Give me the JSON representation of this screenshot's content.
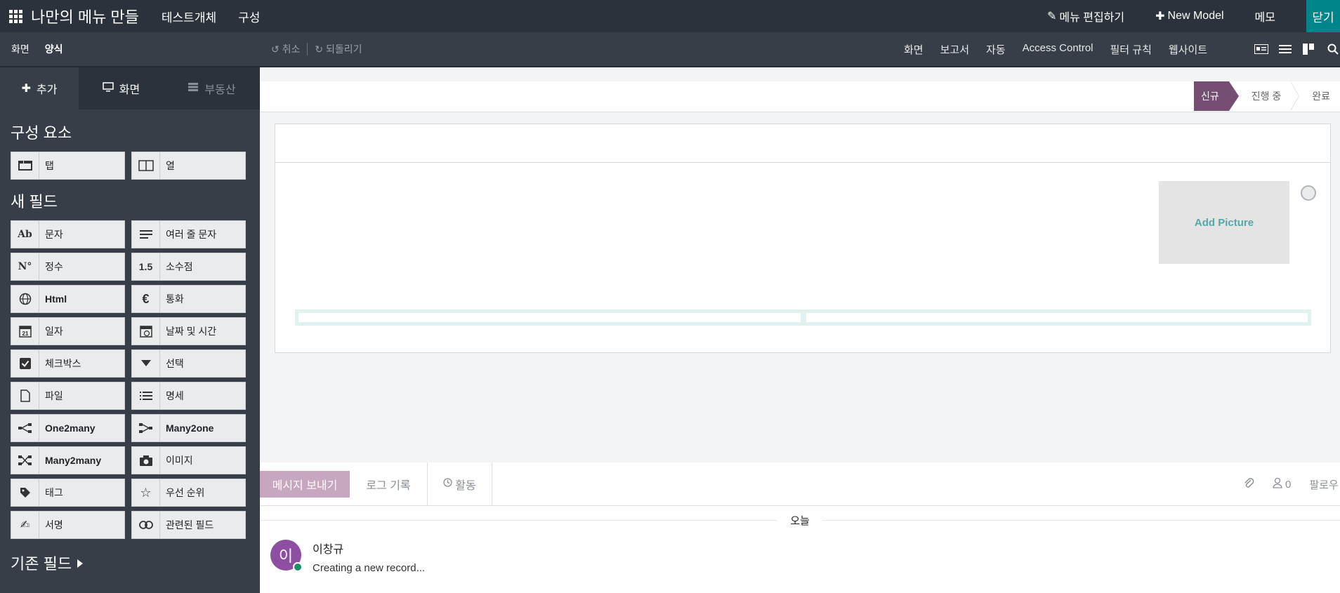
{
  "topbar": {
    "app_title": "나만의 메뉴 만들",
    "menus": [
      "테스트개체",
      "구성"
    ],
    "edit_menu": "메뉴 편집하기",
    "new_model": "New Model",
    "memo": "메모",
    "close": "닫기"
  },
  "subbar": {
    "left": [
      "화면",
      "양식"
    ],
    "undo": "취소",
    "redo": "되돌리기",
    "right": [
      "화면",
      "보고서",
      "자동",
      "Access Control",
      "필터 규칙",
      "웹사이트"
    ]
  },
  "sidebar": {
    "tabs": [
      "추가",
      "화면",
      "부동산"
    ],
    "components_title": "구성 요소",
    "components": [
      {
        "icon": "tab-icon",
        "label": "탭"
      },
      {
        "icon": "columns-icon",
        "label": "열"
      }
    ],
    "new_fields_title": "새 필드",
    "fields": [
      {
        "icon_text": "Ab",
        "icon": "text-icon",
        "label": "문자",
        "bold": false
      },
      {
        "icon_text": "≡",
        "icon": "multiline-icon",
        "label": "여러 줄 문자",
        "bold": false
      },
      {
        "icon_text": "N°",
        "icon": "integer-icon",
        "label": "정수",
        "bold": false
      },
      {
        "icon_text": "1.5",
        "icon": "decimal-icon",
        "label": "소수점",
        "bold": false
      },
      {
        "icon_text": "🌐",
        "icon": "globe-icon",
        "label": "Html",
        "bold": true
      },
      {
        "icon_text": "€",
        "icon": "currency-icon",
        "label": "통화",
        "bold": false
      },
      {
        "icon_text": "21",
        "icon": "calendar-icon",
        "label": "일자",
        "bold": false
      },
      {
        "icon_text": "◷",
        "icon": "datetime-icon",
        "label": "날짜 및 시간",
        "bold": false
      },
      {
        "icon_text": "☑",
        "icon": "checkbox-icon",
        "label": "체크박스",
        "bold": false
      },
      {
        "icon_text": "▼",
        "icon": "select-icon",
        "label": "선택",
        "bold": false
      },
      {
        "icon_text": "🗋",
        "icon": "file-icon",
        "label": "파일",
        "bold": false
      },
      {
        "icon_text": "☰",
        "icon": "lines-icon",
        "label": "명세",
        "bold": false
      },
      {
        "icon_text": "⋲",
        "icon": "one2many-icon",
        "label": "One2many",
        "bold": true
      },
      {
        "icon_text": "⋺",
        "icon": "many2one-icon",
        "label": "Many2one",
        "bold": true
      },
      {
        "icon_text": "⤨",
        "icon": "many2many-icon",
        "label": "Many2many",
        "bold": true
      },
      {
        "icon_text": "📷",
        "icon": "camera-icon",
        "label": "이미지",
        "bold": false
      },
      {
        "icon_text": "🏷",
        "icon": "tag-icon",
        "label": "태그",
        "bold": false
      },
      {
        "icon_text": "☆",
        "icon": "priority-icon",
        "label": "우선 순위",
        "bold": false
      },
      {
        "icon_text": "✍",
        "icon": "signature-icon",
        "label": "서명",
        "bold": false
      },
      {
        "icon_text": "⛓",
        "icon": "link-icon",
        "label": "관련된 필드",
        "bold": false
      }
    ],
    "existing_fields": "기존 필드"
  },
  "main": {
    "stages": [
      "신규",
      "진행 중",
      "완료"
    ],
    "picture_label": "Add Picture"
  },
  "chatter": {
    "send": "메시지 보내기",
    "log": "로그 기록",
    "activity": "활동",
    "followers_count": "0",
    "follow": "팔로우",
    "today": "오늘",
    "author_initial": "이",
    "author": "이창규",
    "message": "Creating a new record..."
  }
}
